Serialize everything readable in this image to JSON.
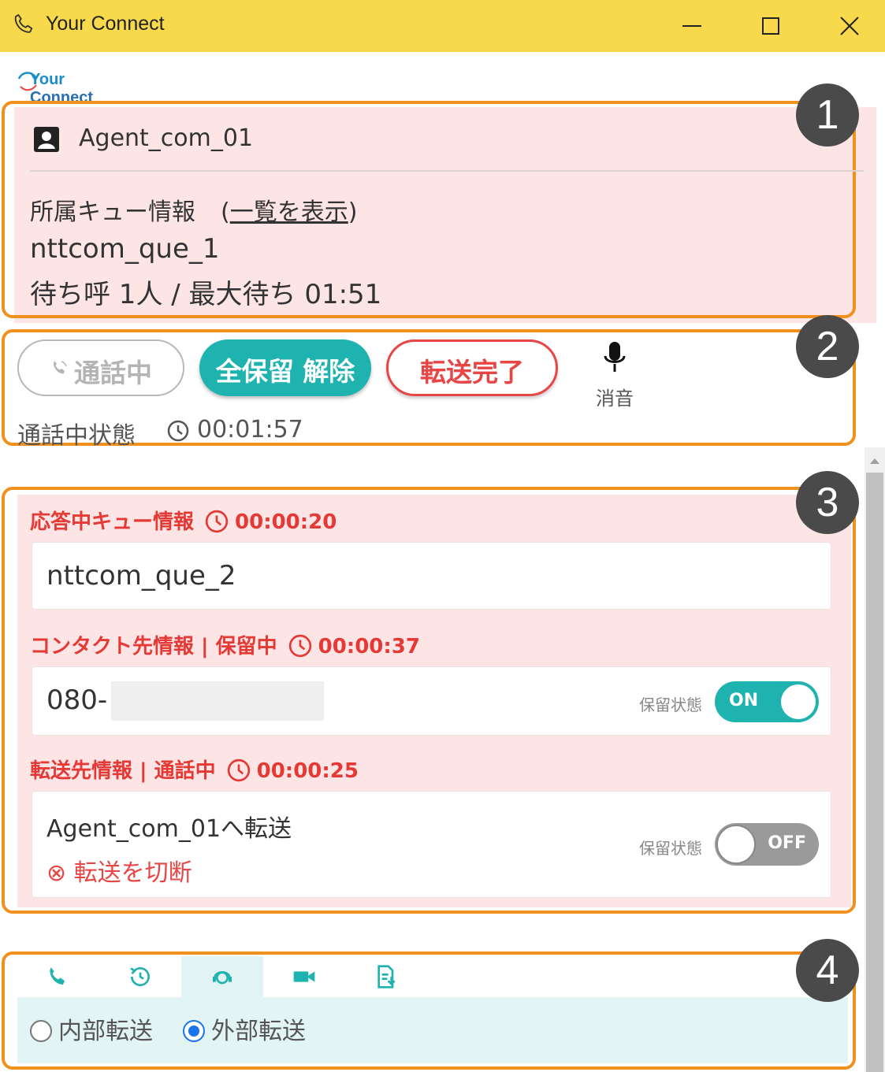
{
  "window": {
    "title": "Your Connect"
  },
  "logo": {
    "part1": "Your",
    "part2": "Connect"
  },
  "badges": [
    "1",
    "2",
    "3",
    "4"
  ],
  "agent": {
    "name": "Agent_com_01",
    "queue_label": "所属キュー情報",
    "queue_link_open": "(",
    "queue_link": "一覧を表示",
    "queue_link_close": ")",
    "queue_name": "nttcom_que_1",
    "wait_info": "待ち呼 1人 / 最大待ち 01:51"
  },
  "controls": {
    "talk_label": "通話中",
    "hold_label": "全保留 解除",
    "transfer_label": "転送完了",
    "mute_label": "消音",
    "status_label": "通話中状態",
    "status_timer": "00:01:57"
  },
  "details": {
    "queue_header": "応答中キュー情報",
    "queue_timer": "00:00:20",
    "queue_value": "nttcom_que_2",
    "contact_header": "コンタクト先情報 | 保留中",
    "contact_timer": "00:00:37",
    "contact_value": "080-",
    "contact_hold_label": "保留状態",
    "contact_hold_state": "ON",
    "transfer_header": "転送先情報 | 通話中",
    "transfer_timer": "00:00:25",
    "transfer_value": "Agent_com_01へ転送",
    "transfer_cut": "⊗ 転送を切断",
    "transfer_hold_label": "保留状態",
    "transfer_hold_state": "OFF"
  },
  "transfer_panel": {
    "tabs": [
      "phone-icon",
      "history-icon",
      "agent-support-icon",
      "video-icon",
      "document-icon"
    ],
    "active_tab": 2,
    "internal_label": "内部転送",
    "external_label": "外部転送",
    "selected": "external"
  },
  "colors": {
    "titlebar": "#f8d94c",
    "highlight": "#f0911e",
    "teal": "#1fb3b0",
    "red": "#e53935",
    "pink_bg": "#fde5e5"
  }
}
